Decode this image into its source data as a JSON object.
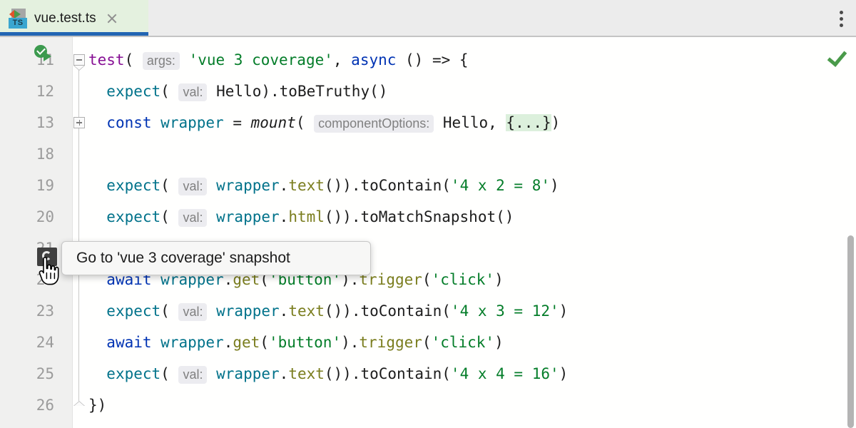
{
  "window": {
    "title": "vue.test.ts"
  },
  "tabbar": {
    "tab_label": "vue.test.ts",
    "tab_icon": "typescript-test-file-icon",
    "ts_badge": "TS",
    "close_icon": "close-icon",
    "menu_icon": "more-vertical-icon",
    "active_accent": "#2265b3",
    "tab_background": "#e4f1df"
  },
  "tooltip": {
    "text": "Go to 'vue 3 coverage' snapshot",
    "visible": true
  },
  "gutter": {
    "run_icon_line": 11,
    "run_icon_name": "run-test-success-icon",
    "snapshot_icon_line": 20,
    "snapshot_icon_name": "snapshot-gutter-icon"
  },
  "editor": {
    "inspection_status": "ok",
    "inspection_icon": "green-checkmark-icon",
    "scroll_thumb_visible": true,
    "lines": [
      {
        "number": "11",
        "fold": "minus",
        "tokens": [
          {
            "text": "test",
            "cls": "t-fn-test"
          },
          {
            "text": "(",
            "cls": "t-plain"
          },
          {
            "text": " ",
            "cls": "t-plain"
          },
          {
            "text": "args:",
            "cls": "hint"
          },
          {
            "text": " ",
            "cls": "t-plain"
          },
          {
            "text": "'vue 3 coverage'",
            "cls": "t-str"
          },
          {
            "text": ", ",
            "cls": "t-plain"
          },
          {
            "text": "async",
            "cls": "t-kw"
          },
          {
            "text": " () => {",
            "cls": "t-plain"
          }
        ]
      },
      {
        "number": "12",
        "fold": "",
        "tokens": [
          {
            "text": "  ",
            "cls": "t-plain"
          },
          {
            "text": "expect",
            "cls": "t-fn"
          },
          {
            "text": "(",
            "cls": "t-plain"
          },
          {
            "text": " ",
            "cls": "t-plain"
          },
          {
            "text": "val:",
            "cls": "hint"
          },
          {
            "text": " ",
            "cls": "t-plain"
          },
          {
            "text": "Hello",
            "cls": "t-plain"
          },
          {
            "text": ").",
            "cls": "t-plain"
          },
          {
            "text": "toBeTruthy",
            "cls": "t-plain"
          },
          {
            "text": "()",
            "cls": "t-plain"
          }
        ]
      },
      {
        "number": "13",
        "fold": "plus",
        "tokens": [
          {
            "text": "  ",
            "cls": "t-plain"
          },
          {
            "text": "const",
            "cls": "t-kw"
          },
          {
            "text": " ",
            "cls": "t-plain"
          },
          {
            "text": "wrapper",
            "cls": "t-ident"
          },
          {
            "text": " = ",
            "cls": "t-plain"
          },
          {
            "text": "mount",
            "cls": "t-italic"
          },
          {
            "text": "(",
            "cls": "t-plain"
          },
          {
            "text": " ",
            "cls": "t-plain"
          },
          {
            "text": "componentOptions:",
            "cls": "hint"
          },
          {
            "text": " ",
            "cls": "t-plain"
          },
          {
            "text": "Hello",
            "cls": "t-plain"
          },
          {
            "text": ", ",
            "cls": "t-plain"
          },
          {
            "text": "{...}",
            "cls": "fold-chip"
          },
          {
            "text": ")",
            "cls": "t-plain"
          }
        ]
      },
      {
        "number": "18",
        "fold": "",
        "tokens": []
      },
      {
        "number": "19",
        "fold": "",
        "tokens": [
          {
            "text": "  ",
            "cls": "t-plain"
          },
          {
            "text": "expect",
            "cls": "t-fn"
          },
          {
            "text": "(",
            "cls": "t-plain"
          },
          {
            "text": " ",
            "cls": "t-plain"
          },
          {
            "text": "val:",
            "cls": "hint"
          },
          {
            "text": " ",
            "cls": "t-plain"
          },
          {
            "text": "wrapper",
            "cls": "t-ident"
          },
          {
            "text": ".",
            "cls": "t-plain"
          },
          {
            "text": "text",
            "cls": "t-method"
          },
          {
            "text": "()).",
            "cls": "t-plain"
          },
          {
            "text": "toContain",
            "cls": "t-plain"
          },
          {
            "text": "(",
            "cls": "t-plain"
          },
          {
            "text": "'4 x 2 = 8'",
            "cls": "t-str"
          },
          {
            "text": ")",
            "cls": "t-plain"
          }
        ]
      },
      {
        "number": "20",
        "fold": "",
        "tokens": [
          {
            "text": "  ",
            "cls": "t-plain"
          },
          {
            "text": "expect",
            "cls": "t-fn"
          },
          {
            "text": "(",
            "cls": "t-plain"
          },
          {
            "text": " ",
            "cls": "t-plain"
          },
          {
            "text": "val:",
            "cls": "hint"
          },
          {
            "text": " ",
            "cls": "t-plain"
          },
          {
            "text": "wrapper",
            "cls": "t-ident"
          },
          {
            "text": ".",
            "cls": "t-plain"
          },
          {
            "text": "html",
            "cls": "t-method"
          },
          {
            "text": "()).",
            "cls": "t-plain"
          },
          {
            "text": "toMatchSnapshot",
            "cls": "t-plain"
          },
          {
            "text": "()",
            "cls": "t-plain"
          }
        ]
      },
      {
        "number": "21",
        "fold": "",
        "tokens": []
      },
      {
        "number": "22",
        "fold": "",
        "tokens": [
          {
            "text": "  ",
            "cls": "t-plain"
          },
          {
            "text": "await",
            "cls": "t-kw"
          },
          {
            "text": " ",
            "cls": "t-plain"
          },
          {
            "text": "wrapper",
            "cls": "t-ident"
          },
          {
            "text": ".",
            "cls": "t-plain"
          },
          {
            "text": "get",
            "cls": "t-method"
          },
          {
            "text": "(",
            "cls": "t-plain"
          },
          {
            "text": "'button'",
            "cls": "t-str"
          },
          {
            "text": ").",
            "cls": "t-plain"
          },
          {
            "text": "trigger",
            "cls": "t-method"
          },
          {
            "text": "(",
            "cls": "t-plain"
          },
          {
            "text": "'click'",
            "cls": "t-str"
          },
          {
            "text": ")",
            "cls": "t-plain"
          }
        ]
      },
      {
        "number": "23",
        "fold": "",
        "tokens": [
          {
            "text": "  ",
            "cls": "t-plain"
          },
          {
            "text": "expect",
            "cls": "t-fn"
          },
          {
            "text": "(",
            "cls": "t-plain"
          },
          {
            "text": " ",
            "cls": "t-plain"
          },
          {
            "text": "val:",
            "cls": "hint"
          },
          {
            "text": " ",
            "cls": "t-plain"
          },
          {
            "text": "wrapper",
            "cls": "t-ident"
          },
          {
            "text": ".",
            "cls": "t-plain"
          },
          {
            "text": "text",
            "cls": "t-method"
          },
          {
            "text": "()).",
            "cls": "t-plain"
          },
          {
            "text": "toContain",
            "cls": "t-plain"
          },
          {
            "text": "(",
            "cls": "t-plain"
          },
          {
            "text": "'4 x 3 = 12'",
            "cls": "t-str"
          },
          {
            "text": ")",
            "cls": "t-plain"
          }
        ]
      },
      {
        "number": "24",
        "fold": "",
        "tokens": [
          {
            "text": "  ",
            "cls": "t-plain"
          },
          {
            "text": "await",
            "cls": "t-kw"
          },
          {
            "text": " ",
            "cls": "t-plain"
          },
          {
            "text": "wrapper",
            "cls": "t-ident"
          },
          {
            "text": ".",
            "cls": "t-plain"
          },
          {
            "text": "get",
            "cls": "t-method"
          },
          {
            "text": "(",
            "cls": "t-plain"
          },
          {
            "text": "'button'",
            "cls": "t-str"
          },
          {
            "text": ").",
            "cls": "t-plain"
          },
          {
            "text": "trigger",
            "cls": "t-method"
          },
          {
            "text": "(",
            "cls": "t-plain"
          },
          {
            "text": "'click'",
            "cls": "t-str"
          },
          {
            "text": ")",
            "cls": "t-plain"
          }
        ]
      },
      {
        "number": "25",
        "fold": "",
        "tokens": [
          {
            "text": "  ",
            "cls": "t-plain"
          },
          {
            "text": "expect",
            "cls": "t-fn"
          },
          {
            "text": "(",
            "cls": "t-plain"
          },
          {
            "text": " ",
            "cls": "t-plain"
          },
          {
            "text": "val:",
            "cls": "hint"
          },
          {
            "text": " ",
            "cls": "t-plain"
          },
          {
            "text": "wrapper",
            "cls": "t-ident"
          },
          {
            "text": ".",
            "cls": "t-plain"
          },
          {
            "text": "text",
            "cls": "t-method"
          },
          {
            "text": "()).",
            "cls": "t-plain"
          },
          {
            "text": "toContain",
            "cls": "t-plain"
          },
          {
            "text": "(",
            "cls": "t-plain"
          },
          {
            "text": "'4 x 4 = 16'",
            "cls": "t-str"
          },
          {
            "text": ")",
            "cls": "t-plain"
          }
        ]
      },
      {
        "number": "26",
        "fold": "end",
        "tokens": [
          {
            "text": "})",
            "cls": "t-plain"
          }
        ]
      }
    ]
  }
}
